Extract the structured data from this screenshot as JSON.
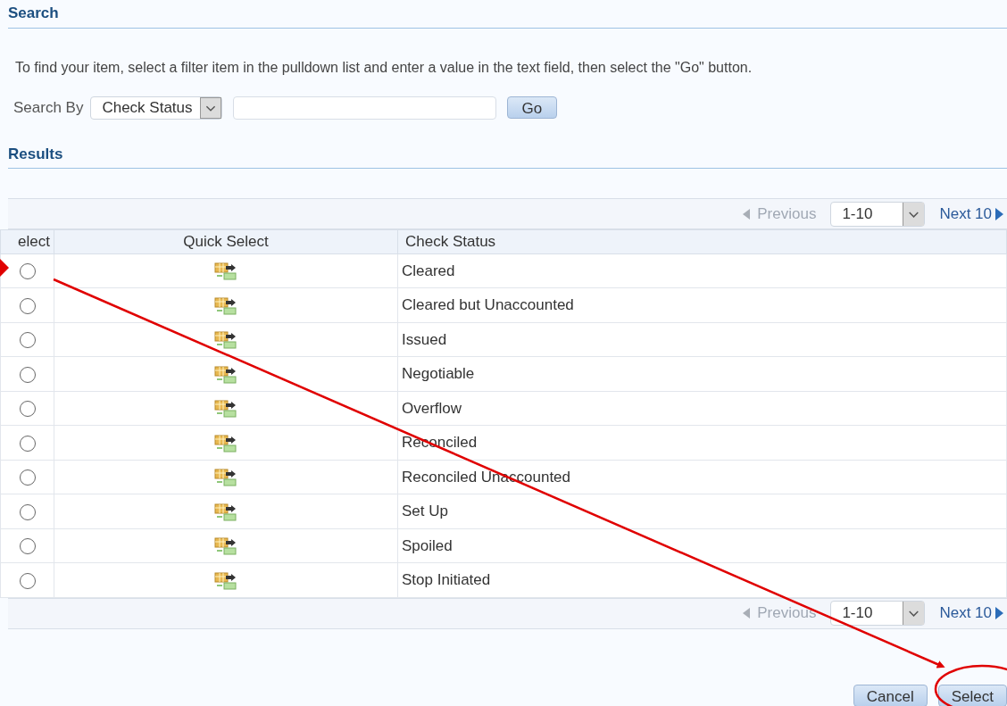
{
  "search": {
    "heading": "Search",
    "instructions": "To find your item, select a filter item in the pulldown list and enter a value in the text field, then select the \"Go\" button.",
    "search_by_label": "Search By",
    "filter": "Check Status",
    "go_button": "Go"
  },
  "results": {
    "heading": "Results",
    "pagination_top": {
      "previous": "Previous",
      "range": "1-10",
      "next": "Next 10"
    },
    "columns": [
      "elect",
      "Quick Select",
      "Check Status"
    ],
    "rows": [
      {
        "selected": false,
        "status": "Cleared"
      },
      {
        "selected": false,
        "status": "Cleared but Unaccounted"
      },
      {
        "selected": false,
        "status": "Issued"
      },
      {
        "selected": false,
        "status": "Negotiable"
      },
      {
        "selected": false,
        "status": "Overflow"
      },
      {
        "selected": false,
        "status": "Reconciled"
      },
      {
        "selected": false,
        "status": "Reconciled Unaccounted"
      },
      {
        "selected": false,
        "status": "Set Up"
      },
      {
        "selected": false,
        "status": "Spoiled"
      },
      {
        "selected": false,
        "status": "Stop Initiated"
      }
    ],
    "pagination_bottom": {
      "previous": "Previous",
      "range": "1-10",
      "next": "Next 10"
    }
  },
  "buttons": [
    "Cancel",
    "Select"
  ],
  "annotations": [
    {
      "kind": "arrowhead"
    },
    {
      "kind": "arrow"
    },
    {
      "kind": "ellipse"
    }
  ]
}
